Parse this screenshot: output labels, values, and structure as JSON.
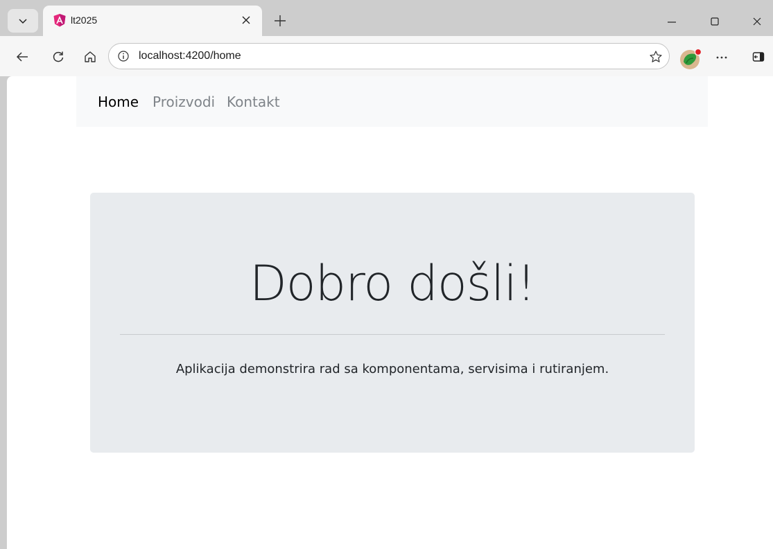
{
  "browser": {
    "tab": {
      "title": "lt2025",
      "favicon": "angular-logo-icon"
    },
    "icons": {
      "tab_search": "chevron-down-icon",
      "tab_close": "close-icon",
      "new_tab": "plus-icon",
      "minimize": "minimize-icon",
      "maximize": "maximize-icon",
      "close_window": "close-icon",
      "back": "back-arrow-icon",
      "refresh": "refresh-icon",
      "home": "home-icon",
      "site_info": "info-icon",
      "favorite": "star-icon",
      "more": "more-dots-icon",
      "sidebar": "sidebar-icon"
    },
    "address": {
      "url": "localhost:4200/home"
    }
  },
  "page": {
    "nav": {
      "items": [
        {
          "label": "Home",
          "active": true,
          "color": "#000000"
        },
        {
          "label": "Proizvodi",
          "active": false,
          "color": "#7f8489"
        },
        {
          "label": "Kontakt",
          "active": false,
          "color": "#7f8489"
        }
      ]
    },
    "hero": {
      "title": "Dobro došli!",
      "lead": "Aplikacija demonstrira rad sa komponentama, servisima i rutiranjem."
    }
  },
  "colors": {
    "chrome": "#cdcdcd",
    "toolbar": "#f6f6f6",
    "navbar": "#f8f9fa",
    "hero_bg": "#e8ebee",
    "text": "#212529"
  }
}
